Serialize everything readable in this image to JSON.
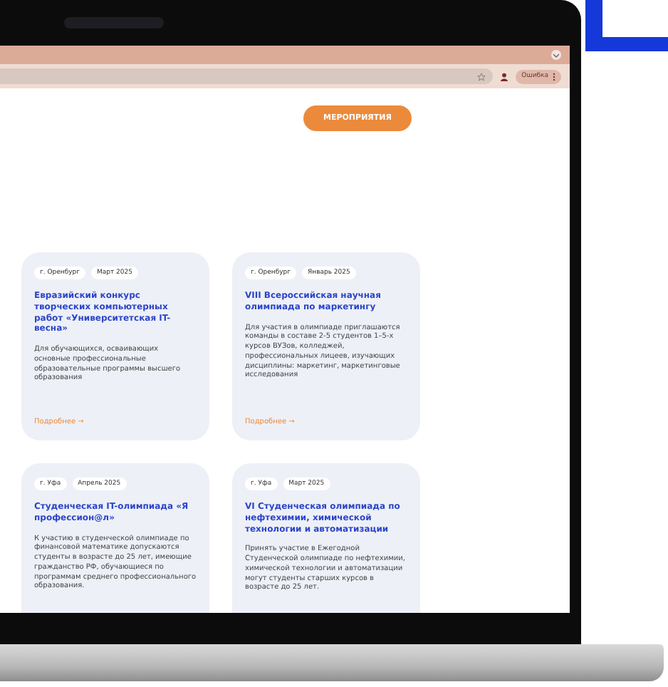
{
  "browser": {
    "profile_button": "Ошибка"
  },
  "nav_button": "МЕРОПРИЯТИЯ",
  "cards": [
    {
      "city": "г. Оренбург",
      "date": "Март 2025",
      "title": "Евразийский конкурс творческих компьютерных работ «Университетская IT-весна»",
      "description": "Для обучающихся, осваивающих основные профессиональные образовательные программы высшего образования",
      "link": "Подробнее →"
    },
    {
      "city": "г. Оренбург",
      "date": "Январь 2025",
      "title": "VIII Всероссийская научная олимпиада по маркетингу",
      "description": "Для участия в олимпиаде приглашаются команды в составе 2-5 студентов 1–5-х курсов ВУЗов, колледжей, профессиональных лицеев, изучающих дисциплины: маркетинг, маркетинговые исследования",
      "link": "Подробнее →"
    },
    {
      "city": "г. Уфа",
      "date": "Апрель 2025",
      "title": "Студенческая IT-олимпиада «Я профессион@л»",
      "description": "К участию в студенческой олимпиаде по финансовой математике допускаются студенты в возрасте до 25 лет, имеющие гражданство РФ, обучающиеся по программам среднего профессионального образования."
    },
    {
      "city": "г. Уфа",
      "date": "Март 2025",
      "title": "VI Студенческая олимпиада по нефтехимии, химической технологии и автоматизации",
      "description": "Принять участие в Ежегодной Студенческой олимпиаде по нефтехимии, химической технологии и автоматизации могут студенты старших курсов в возрасте до 25 лет."
    }
  ]
}
